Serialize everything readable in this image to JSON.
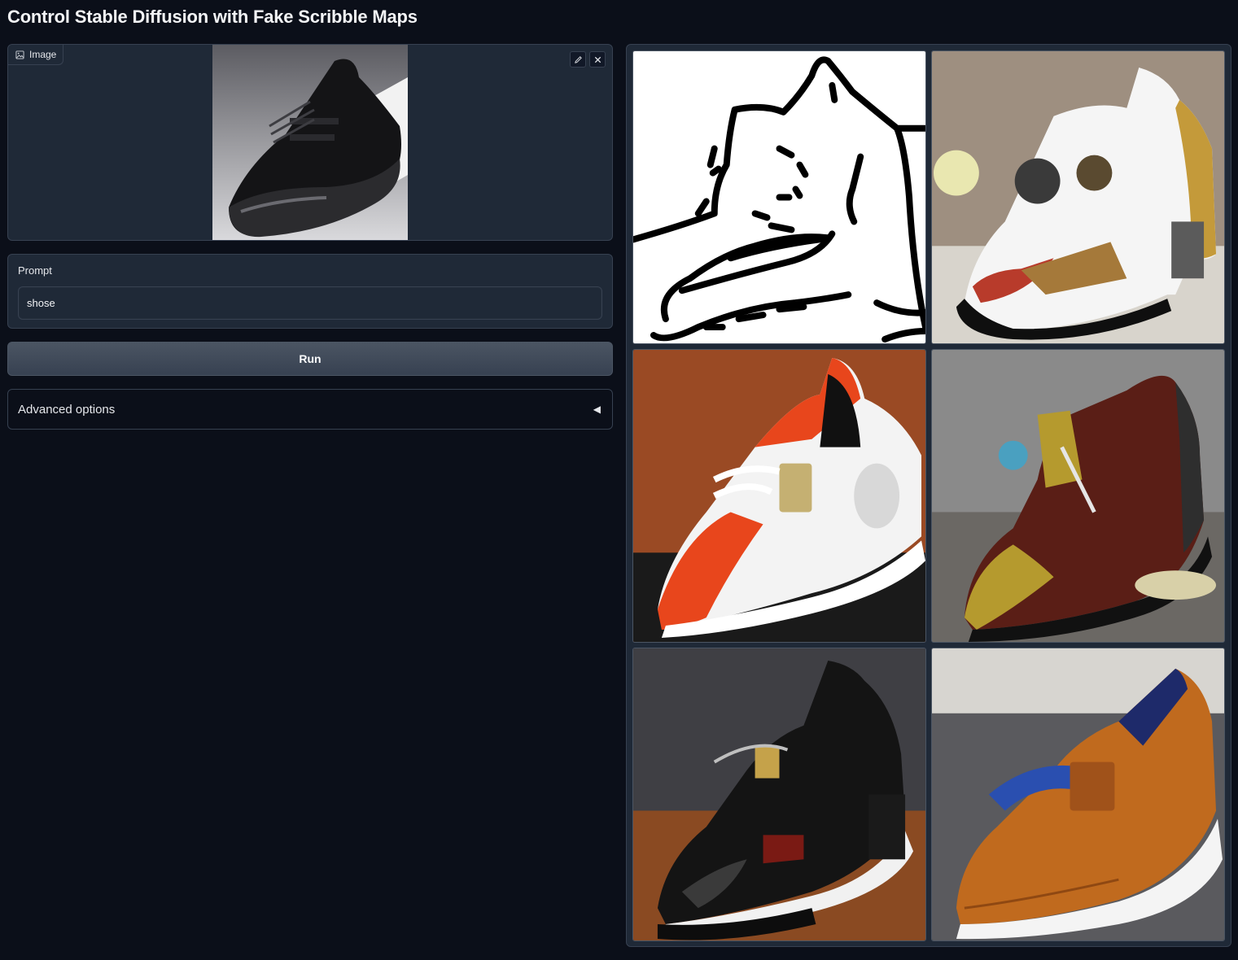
{
  "header": {
    "title": "Control Stable Diffusion with Fake Scribble Maps"
  },
  "image_input": {
    "label": "Image",
    "label_icon": "image-icon",
    "tools": [
      "edit-icon",
      "close-icon"
    ]
  },
  "prompt": {
    "label": "Prompt",
    "value": "shose"
  },
  "run": {
    "label": "Run"
  },
  "advanced": {
    "label": "Advanced options",
    "arrow": "◀"
  },
  "gallery": {
    "items": [
      {
        "kind": "scribble-map",
        "colors": [
          "#ffffff",
          "#000000"
        ]
      },
      {
        "kind": "shoe-white-black",
        "colors": [
          "#f4f4f4",
          "#0f0f0f",
          "#c49a3a"
        ]
      },
      {
        "kind": "shoe-orange-white",
        "colors": [
          "#e8461c",
          "#f5f5f5",
          "#9a4a24"
        ]
      },
      {
        "kind": "shoe-brown-gold",
        "colors": [
          "#5a1e16",
          "#b59a2e",
          "#3b3b3b"
        ]
      },
      {
        "kind": "shoe-black-leather",
        "colors": [
          "#141414",
          "#c4c4c4",
          "#8a4a22"
        ]
      },
      {
        "kind": "shoe-tan-leather",
        "colors": [
          "#c06a1e",
          "#ffffff",
          "#2a4fb0"
        ]
      }
    ]
  }
}
